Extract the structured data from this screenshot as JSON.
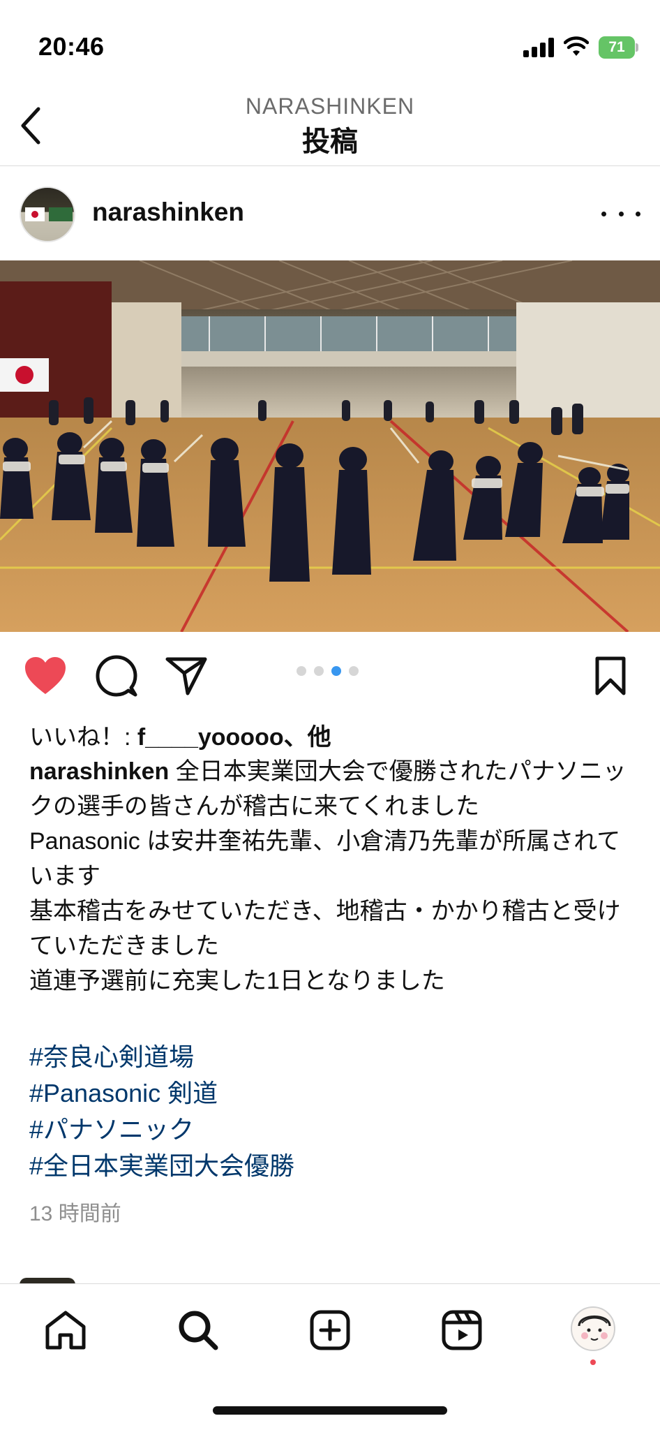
{
  "status_bar": {
    "time": "20:46",
    "battery": "71"
  },
  "header": {
    "account": "NARASHINKEN",
    "title": "投稿"
  },
  "post": {
    "username": "narashinken",
    "likes_prefix": "いいね！: ",
    "likes_user": "f____yooooo",
    "likes_suffix": "、他",
    "caption_lines": [
      "全日本実業団大会で優勝されたパナソニックの選手の皆さんが稽古に来てくれました",
      "Panasonic は安井奎祐先輩、小倉清乃先輩が所属されています",
      "基本稽古をみせていただき、地稽古・かかり稽古と受けていただきました",
      "道連予選前に充実した1日となりました"
    ],
    "hashtags": [
      "#奈良心剣道場",
      "#Panasonic 剣道",
      "#パナソニック",
      "#全日本実業団大会優勝"
    ],
    "timestamp": "13 時間前",
    "carousel_pages": 4,
    "carousel_active_index": 2,
    "liked": true
  },
  "icons": {
    "back": "chevron-left-icon",
    "more": "more-horizontal-icon",
    "like": "heart-filled-icon",
    "comment": "comment-icon",
    "share": "send-icon",
    "save": "bookmark-icon",
    "home": "home-icon",
    "search": "search-icon",
    "create": "plus-square-icon",
    "reels": "reels-icon",
    "profile": "profile-avatar-icon"
  },
  "colors": {
    "heart": "#ed4956",
    "hashtag": "#00376b",
    "carousel_active": "#3897f0",
    "battery": "#65c466",
    "muted": "#8e8e8e"
  }
}
